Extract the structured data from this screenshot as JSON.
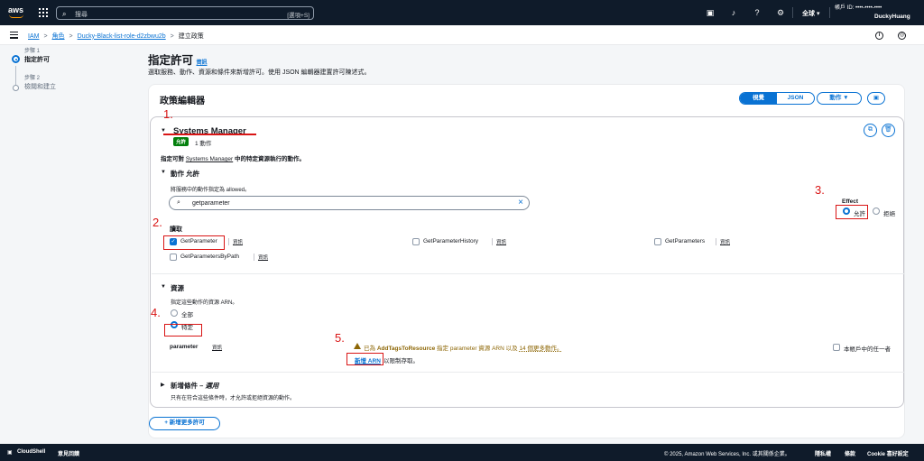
{
  "topnav": {
    "search_placeholder": "搜尋",
    "search_hint": "[選項+S]",
    "region": "全球",
    "account_line": "帳戶 ID: ••••-••••-••••",
    "user": "DuckyHuang"
  },
  "breadcrumb": {
    "items": [
      "IAM",
      "角色",
      "Ducky-Black-list-role-d2zbwu2b"
    ],
    "current": "建立政策"
  },
  "steps": [
    {
      "step": "步驟 1",
      "name": "指定許可",
      "active": true
    },
    {
      "step": "步驟 2",
      "name": "檢閱和建立",
      "active": false
    }
  ],
  "page": {
    "title": "指定許可",
    "info": "資訊",
    "description": "選取服務、動作、資源和條件來新增許可。使用 JSON 編輯器建置許可陳述式。"
  },
  "editor": {
    "title": "政策編輯器",
    "view_visual": "視覺",
    "view_json": "JSON",
    "actions_button": "動作 ▼"
  },
  "service": {
    "name": "Systems Manager",
    "badge": "允許",
    "count": "1 動作",
    "desc_prefix": "指定可對",
    "desc_link": "Systems Manager",
    "desc_suffix": "中的特定資源執行的動作。",
    "actions_heading": "動作 允許",
    "actions_note": "將服務中的動作指定為 allowed。",
    "filter_value": "getparameter",
    "effect_label": "Effect",
    "effect_allow": "允許",
    "effect_deny": "拒絕",
    "read_label": "讀取",
    "actions": [
      {
        "label": "GetParameter",
        "checked": true
      },
      {
        "label": "GetParameterHistory",
        "checked": false
      },
      {
        "label": "GetParameters",
        "checked": false
      },
      {
        "label": "GetParametersByPath",
        "checked": false
      }
    ],
    "info": "資訊",
    "resources_heading": "資源",
    "resources_note": "指定這些動作的資源 ARN。",
    "res_all": "全部",
    "res_specific": "特定",
    "param_label": "parameter",
    "warn_prefix": "已為",
    "warn_action": "AddTagsToResource",
    "warn_mid": "指定 parameter 資源 ARN 以及",
    "warn_more": "14 個更多動作。",
    "add_arn": "新增 ARN",
    "add_arn_tail": "以限制存取。",
    "any_account": "本帳戶中的任一者",
    "conditions_heading": "新增條件",
    "conditions_optional": "– 選用",
    "conditions_note": "只有在符合這些條件時，才允許或拒絕資源的動作。"
  },
  "add_more_permissions": "+ 新增更多許可",
  "annotations": [
    "1.",
    "2.",
    "3.",
    "4.",
    "5."
  ],
  "footer": {
    "cloudshell": "CloudShell",
    "feedback": "意見回饋",
    "copyright": "© 2025, Amazon Web Services, Inc. 或其關係企業。",
    "privacy": "隱私權",
    "terms": "條款",
    "cookie": "Cookie 喜好設定"
  },
  "colors": {
    "accent": "#0972d3",
    "navbar": "#0f1b2a",
    "success": "#037f0c",
    "annotation": "#d91515"
  }
}
